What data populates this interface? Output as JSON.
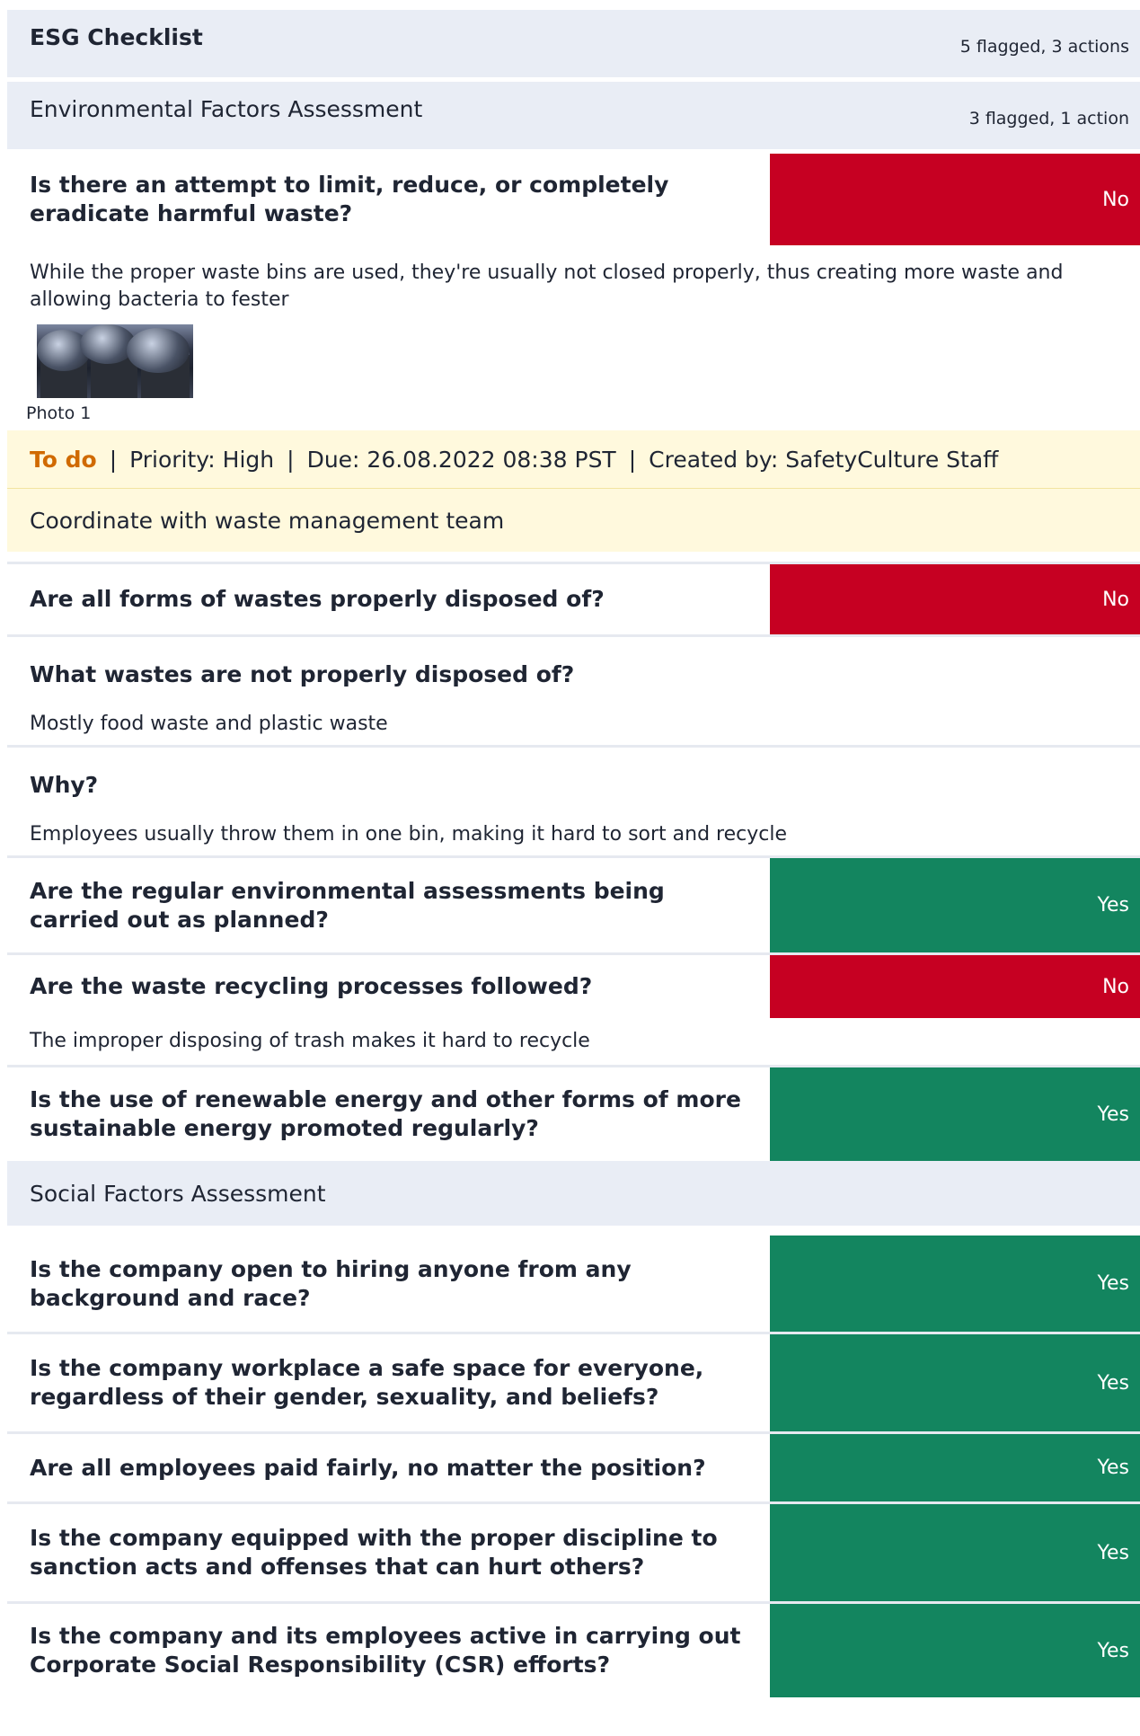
{
  "checklist": {
    "title": "ESG Checklist",
    "summary": "5 flagged, 3 actions"
  },
  "environmental": {
    "title": "Environmental Factors Assessment",
    "summary": "3 flagged, 1 action",
    "items": [
      {
        "question": "Is there an attempt to limit, reduce, or completely eradicate harmful waste?",
        "answer": "No",
        "note": "While the proper waste bins are used, they're usually not closed properly, thus creating more waste and allowing bacteria to fester",
        "photo_caption": "Photo 1",
        "action": {
          "status": "To do",
          "priority": "Priority: High",
          "due": "Due: 26.08.2022 08:38 PST",
          "created_by": "Created by: SafetyCulture Staff",
          "title": "Coordinate with waste management team"
        }
      },
      {
        "question": "Are all forms of wastes properly disposed of?",
        "answer": "No",
        "sub_questions": [
          {
            "question": "What wastes are not properly disposed of?",
            "answer": "Mostly food waste and plastic waste"
          },
          {
            "question": "Why?",
            "answer": "Employees usually throw them in one bin, making it hard to sort and recycle"
          }
        ]
      },
      {
        "question": "Are the regular environmental assessments being carried out as planned?",
        "answer": "Yes"
      },
      {
        "question": "Are the waste recycling processes followed?",
        "answer": "No",
        "note": "The improper disposing of trash makes it hard to recycle"
      },
      {
        "question": "Is the use of renewable energy and other forms of more sustainable energy promoted regularly?",
        "answer": "Yes"
      }
    ]
  },
  "social": {
    "title": "Social Factors Assessment",
    "items": [
      {
        "question": "Is the company open to hiring anyone from any background and race?",
        "answer": "Yes"
      },
      {
        "question": "Is the company workplace a safe space for everyone, regardless of their gender, sexuality, and beliefs?",
        "answer": "Yes"
      },
      {
        "question": "Are all employees paid fairly, no matter the position?",
        "answer": "Yes"
      },
      {
        "question": "Is the company equipped with the proper discipline to sanction acts and offenses that can hurt others?",
        "answer": "Yes"
      },
      {
        "question": "Is the company and its employees active in carrying out Corporate Social Responsibility (CSR) efforts?",
        "answer": "Yes"
      }
    ]
  },
  "colors": {
    "no": "#c60022",
    "yes": "#13855f",
    "section_bg": "#e9edf5",
    "action_bg": "#fff9dd",
    "todo": "#d06a00"
  }
}
